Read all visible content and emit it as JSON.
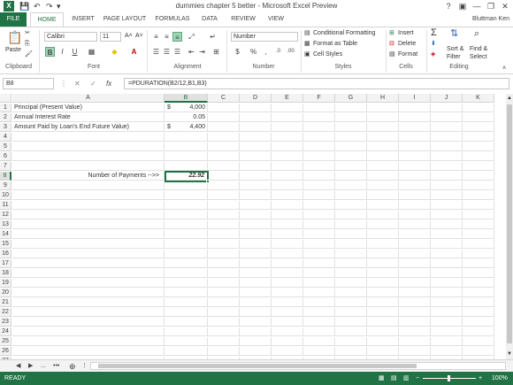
{
  "window": {
    "title": "dummies chapter 5 better - Microsoft Excel Preview",
    "logo": "X",
    "help": "?",
    "minimize": "—",
    "restore": "❐",
    "close": "✕",
    "ribbon_display": "▣"
  },
  "qat": {
    "save": "💾",
    "undo": "↶",
    "redo": "↷",
    "customize": "▾"
  },
  "tabs": [
    "FILE",
    "HOME",
    "INSERT",
    "PAGE LAYOUT",
    "FORMULAS",
    "DATA",
    "REVIEW",
    "VIEW"
  ],
  "user": "Bluttman Ken",
  "ribbon": {
    "clipboard": {
      "label": "Clipboard",
      "paste": "Paste"
    },
    "font": {
      "label": "Font",
      "name": "Calibri",
      "size": "11",
      "bold": "B",
      "italic": "I",
      "underline": "U",
      "grow": "A˄",
      "shrink": "A˅"
    },
    "alignment": {
      "label": "Alignment"
    },
    "number": {
      "label": "Number",
      "format": "Number",
      "currency": "$",
      "percent": "%",
      "comma": ",",
      "inc": ".0",
      "dec": ".00"
    },
    "styles": {
      "label": "Styles",
      "conditional": "Conditional Formatting",
      "table": "Format as Table",
      "cell": "Cell Styles"
    },
    "cells": {
      "label": "Cells",
      "insert": "Insert",
      "delete": "Delete",
      "format": "Format"
    },
    "editing": {
      "label": "Editing",
      "sum": "Σ",
      "sort": "Sort &",
      "filter": "Filter",
      "find": "Find &",
      "select": "Select"
    }
  },
  "formula_bar": {
    "name_box": "B8",
    "cancel": "✕",
    "enter": "✓",
    "fx": "fx",
    "formula": "=PDURATION(B2/12,B1,B3)"
  },
  "columns": [
    "A",
    "B",
    "C",
    "D",
    "E",
    "F",
    "G",
    "H",
    "I",
    "J",
    "K"
  ],
  "rows": [
    "1",
    "2",
    "3",
    "4",
    "5",
    "6",
    "7",
    "8",
    "9",
    "10",
    "11",
    "12",
    "13",
    "14",
    "15",
    "16",
    "17",
    "18",
    "19",
    "20",
    "21",
    "22",
    "23",
    "24",
    "25",
    "26",
    "27",
    "28",
    "29"
  ],
  "cells": {
    "A1": "Principal (Present Value)",
    "A2": "Annual Interest Rate",
    "A3": "Amount Paid by Loan's End Future Value)",
    "A8": "Number of Payments -->>",
    "B1_sym": "$",
    "B1": "4,000",
    "B2": "0.05",
    "B3_sym": "$",
    "B3": "4,400",
    "B8": "22.92"
  },
  "sheet_nav": {
    "prev": "◀",
    "next": "▶",
    "more": "...",
    "sheet_dots": "•••",
    "add": "⊕"
  },
  "status": {
    "text": "READY",
    "zoom": "100%",
    "zoom_minus": "−",
    "zoom_plus": "+"
  },
  "colors": {
    "accent": "#217346"
  }
}
